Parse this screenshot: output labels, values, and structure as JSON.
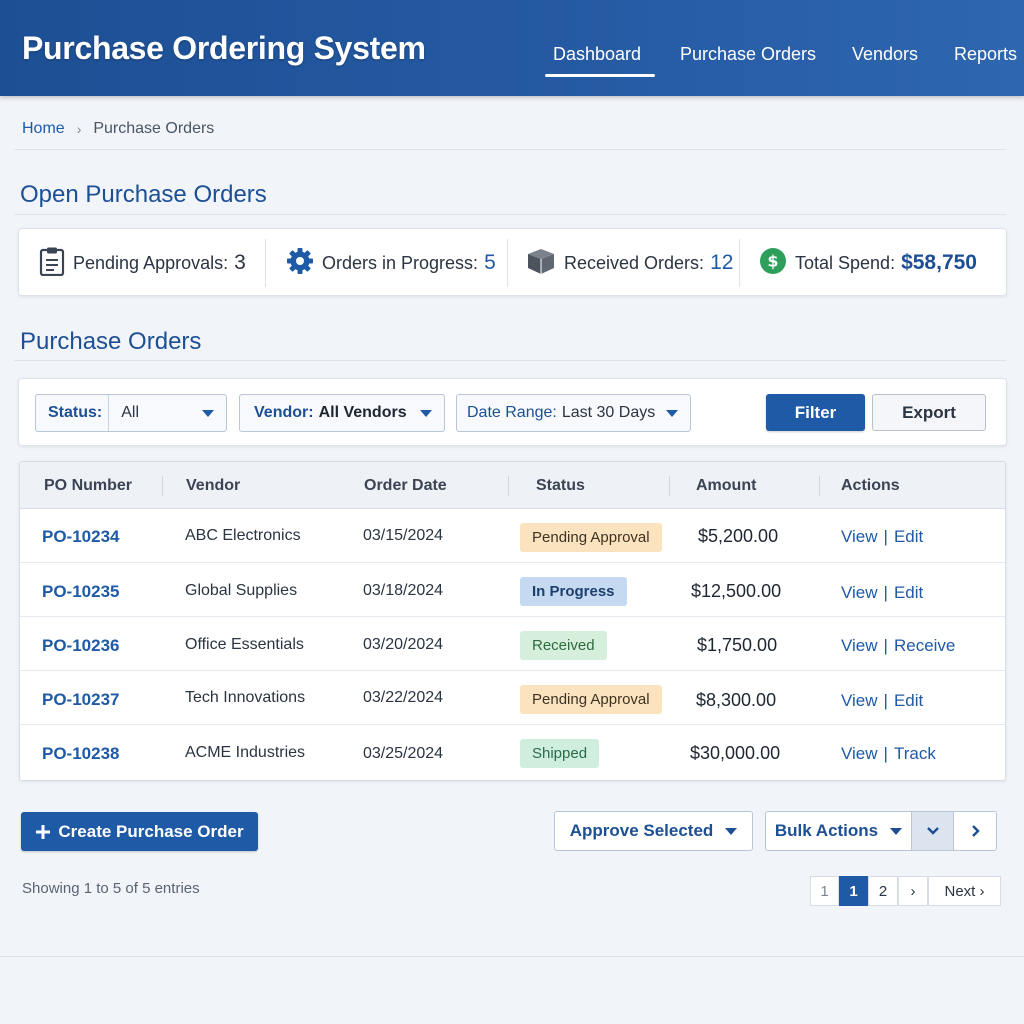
{
  "app": {
    "title": "Purchase Ordering System"
  },
  "nav": {
    "items": [
      {
        "label": "Dashboard",
        "active": true
      },
      {
        "label": "Purchase Orders",
        "active": false
      },
      {
        "label": "Vendors",
        "active": false
      },
      {
        "label": "Reports",
        "active": false
      }
    ]
  },
  "breadcrumb": {
    "home": "Home",
    "separator": "›",
    "current": "Purchase Orders"
  },
  "overview": {
    "title": "Open Purchase Orders",
    "stats": [
      {
        "label": "Pending Approvals:",
        "value": "3",
        "icon": "clipboard-icon"
      },
      {
        "label": "Orders in Progress:",
        "value": "5",
        "icon": "gear-icon"
      },
      {
        "label": "Received Orders:",
        "value": "12",
        "icon": "box-icon"
      },
      {
        "label": "Total Spend:",
        "value": "$58,750",
        "icon": "dollar-icon"
      }
    ]
  },
  "orders_section": {
    "title": "Purchase Orders"
  },
  "filters": {
    "status_label": "Status:",
    "status_value": "All",
    "vendor_label": "Vendor:",
    "vendor_value": "All Vendors",
    "date_label": "Date Range:",
    "date_value": "Last 30 Days",
    "filter_button": "Filter",
    "export_button": "Export"
  },
  "table": {
    "columns": [
      "PO Number",
      "Vendor",
      "Order Date",
      "Status",
      "Amount",
      "Actions"
    ],
    "rows": [
      {
        "po": "PO-10234",
        "vendor": "ABC Electronics",
        "date": "03/15/2024",
        "status": "Pending Approval",
        "amount": "$5,200.00",
        "action1": "View",
        "action2": "Edit"
      },
      {
        "po": "PO-10235",
        "vendor": "Global Supplies",
        "date": "03/18/2024",
        "status": "In Progress",
        "amount": "$12,500.00",
        "action1": "View",
        "action2": "Edit"
      },
      {
        "po": "PO-10236",
        "vendor": "Office Essentials",
        "date": "03/20/2024",
        "status": "Received",
        "amount": "$1,750.00",
        "action1": "View",
        "action2": "Receive"
      },
      {
        "po": "PO-10237",
        "vendor": "Tech Innovations",
        "date": "03/22/2024",
        "status": "Pending Approval",
        "amount": "$8,300.00",
        "action1": "View",
        "action2": "Edit"
      },
      {
        "po": "PO-10238",
        "vendor": "ACME Industries",
        "date": "03/25/2024",
        "status": "Shipped",
        "amount": "$30,000.00",
        "action1": "View",
        "action2": "Track"
      }
    ],
    "action_separator": "|"
  },
  "status_colors": {
    "Pending Approval": {
      "bg": "#fbe3bf",
      "fg": "#3d3322"
    },
    "In Progress": {
      "bg": "#c5d9f1",
      "fg": "#1d3f6e"
    },
    "Received": {
      "bg": "#d6efdc",
      "fg": "#2d6a3f"
    },
    "Shipped": {
      "bg": "#cfeedd",
      "fg": "#2a6b48"
    }
  },
  "colors": {
    "brand": "#1f5aa6",
    "header": "#255aa3",
    "success": "#2e9e5b"
  },
  "actions": {
    "create_button": "Create Purchase Order",
    "create_icon": "plus-icon",
    "approve_button": "Approve Selected",
    "bulk_button": "Bulk Actions"
  },
  "pagination": {
    "summary": "Showing 1 to 5 of 5 entries",
    "first": "1",
    "current": "1",
    "second": "2",
    "next_arrow": "›",
    "next_label": "Next ›"
  }
}
